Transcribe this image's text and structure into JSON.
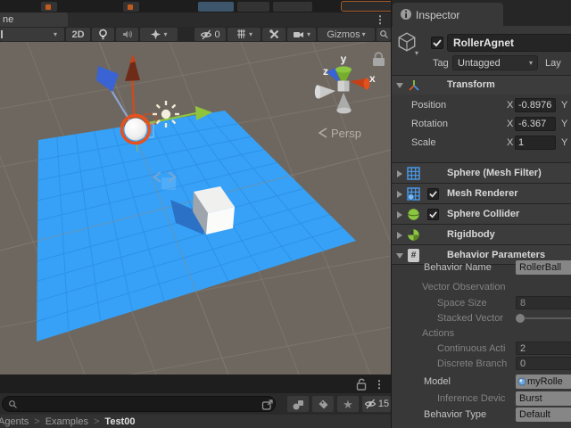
{
  "scene": {
    "tab_label": "ne",
    "toolbar": {
      "mode_2d": "2D",
      "gizmos_label": "Gizmos",
      "eye_count": "0"
    },
    "persp_label": "Persp",
    "axis_labels": {
      "x": "x",
      "y": "y",
      "z": "z"
    }
  },
  "inspector": {
    "tab_label": "Inspector",
    "header": {
      "object_name": "RollerAgnet",
      "tag_label": "Tag",
      "tag_value": "Untagged",
      "layer_label": "Lay"
    },
    "transform": {
      "title": "Transform",
      "rows": [
        {
          "label": "Position",
          "axis_x": "X",
          "value_x": "-0.8976",
          "axis_y": "Y"
        },
        {
          "label": "Rotation",
          "axis_x": "X",
          "value_x": "-6.367",
          "axis_y": "Y"
        },
        {
          "label": "Scale",
          "axis_x": "X",
          "value_x": "1",
          "axis_y": "Y"
        }
      ]
    },
    "components": [
      {
        "title": "Sphere (Mesh Filter)"
      },
      {
        "title": "Mesh Renderer"
      },
      {
        "title": "Sphere Collider"
      },
      {
        "title": "Rigidbody"
      },
      {
        "title": "Behavior Parameters"
      }
    ],
    "behavior": {
      "behavior_name_label": "Behavior Name",
      "behavior_name_value": "RollerBall",
      "vector_observation_label": "Vector Observation",
      "space_size_label": "Space Size",
      "space_size_value": "8",
      "stacked_vectors_label": "Stacked Vector",
      "actions_label": "Actions",
      "continuous_actions_label": "Continuous Acti",
      "continuous_actions_value": "2",
      "discrete_branches_label": "Discrete Branch",
      "discrete_branches_value": "0",
      "model_label": "Model",
      "model_value": "myRolle",
      "inference_device_label": "Inference Devic",
      "inference_device_value": "Burst",
      "behavior_type_label": "Behavior Type",
      "behavior_type_value": "Default"
    }
  },
  "project": {
    "breadcrumb": [
      "Agents",
      "Examples",
      "Test00"
    ],
    "separator": ">",
    "eye_count": "15"
  }
}
